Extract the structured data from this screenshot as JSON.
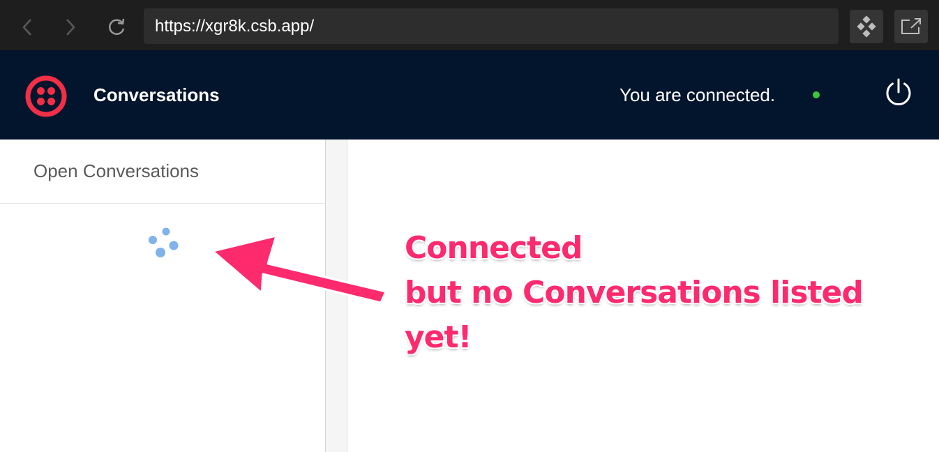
{
  "browser": {
    "url": "https://xgr8k.csb.app/",
    "icons": [
      "back-arrow-icon",
      "forward-arrow-icon",
      "reload-icon",
      "codesandbox-icon",
      "open-external-icon"
    ]
  },
  "header": {
    "title": "Conversations",
    "status_text": "You are connected.",
    "status_color": "#3bc73b",
    "logo_color": "#f22f46",
    "background": "#03152c",
    "icons": [
      "twilio-logo-icon",
      "power-icon"
    ]
  },
  "sidebar": {
    "title": "Open Conversations",
    "loading_icon": "loading-spinner-icon"
  },
  "annotation": {
    "line1": "Connected",
    "line2": "but no Conversations listed",
    "line3": "yet!",
    "color": "#fd2a6e",
    "icon": "annotation-arrow-icon"
  }
}
